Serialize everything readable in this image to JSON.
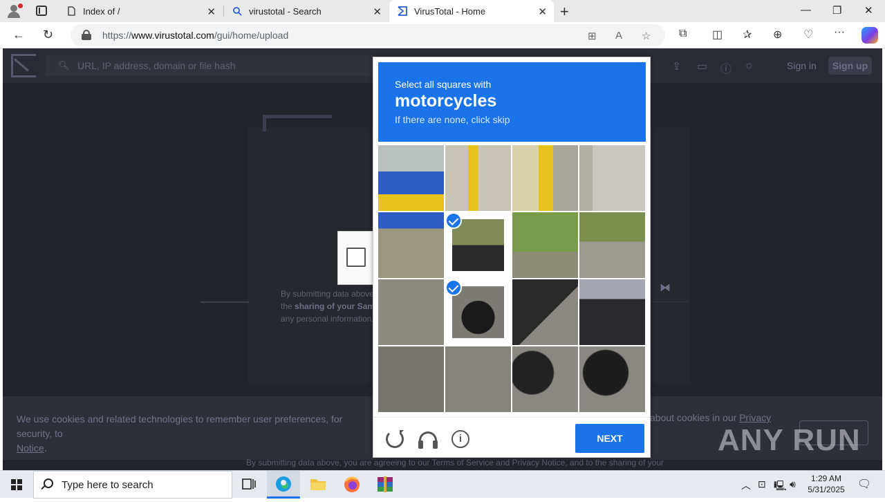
{
  "browser": {
    "tabs": [
      {
        "title": "Index of /",
        "icon": "page-icon"
      },
      {
        "title": "virustotal - Search",
        "icon": "search-icon"
      },
      {
        "title": "VirusTotal - Home",
        "icon": "virustotal-icon",
        "active": true
      }
    ],
    "url_prefix": "https://",
    "url_domain": "www.virustotal.com",
    "url_path": "/gui/home/upload"
  },
  "virustotal": {
    "search_placeholder": "URL, IP address, domain or file hash",
    "sign_in": "Sign in",
    "sign_up": "Sign up",
    "submit_text_1": "By submitting data above,",
    "submit_text_2_pre": "the ",
    "submit_text_2_bold": "sharing of your Sampl",
    "submit_text_3": "any personal information,",
    "cookie_text_1": "We use cookies and related technologies to remember user preferences, for security, to",
    "cookie_text_2": "Notice",
    "cookie_text_2_suffix": ".",
    "cookie_right_pre": "about cookies in our ",
    "cookie_right_link": "Privacy",
    "bottom_terms": "By submitting data above, you are agreeing to our Terms of Service and Privacy Notice, and to the sharing of your"
  },
  "captcha": {
    "instruction_line1": "Select all squares with",
    "target": "motorcycles",
    "instruction_line3": "If there are none, click skip",
    "next_label": "NEXT",
    "selected_tiles": [
      5,
      9
    ],
    "grid_size": 4
  },
  "watermark": "ANY RUN",
  "taskbar": {
    "search_placeholder": "Type here to search",
    "time": "1:29 AM",
    "date": "5/31/2025"
  },
  "colors": {
    "captcha_blue": "#1a73e8",
    "vt_background": "#22242c"
  }
}
